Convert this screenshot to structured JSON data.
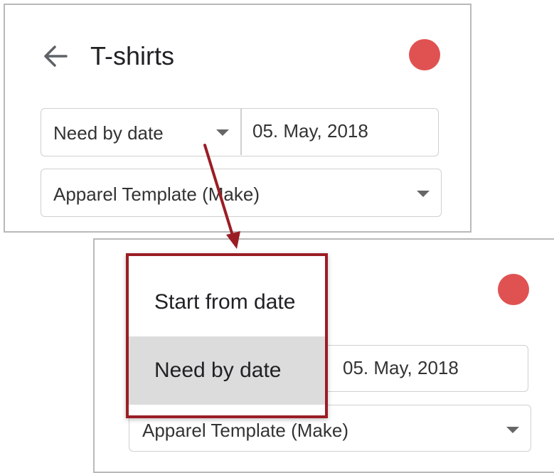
{
  "top_panel": {
    "title": "T-shirts",
    "back_icon": "arrow-left-icon",
    "status_dot_color": "#e05252",
    "date_mode_select": {
      "value": "Need by date"
    },
    "date_field": {
      "value": "05. May, 2018"
    },
    "template_select": {
      "value": "Apparel Template (Make)"
    }
  },
  "bottom_panel": {
    "status_dot_color": "#e05252",
    "date_field": {
      "value": "05. May, 2018"
    },
    "template_select": {
      "value": "Apparel Template (Make)"
    },
    "dropdown_menu": {
      "items": [
        {
          "label": "Start from date",
          "selected": false
        },
        {
          "label": "Need by date",
          "selected": true
        }
      ],
      "highlight_color": "#9b1d24"
    }
  },
  "annotation": {
    "arrow_color": "#9b1d24"
  }
}
